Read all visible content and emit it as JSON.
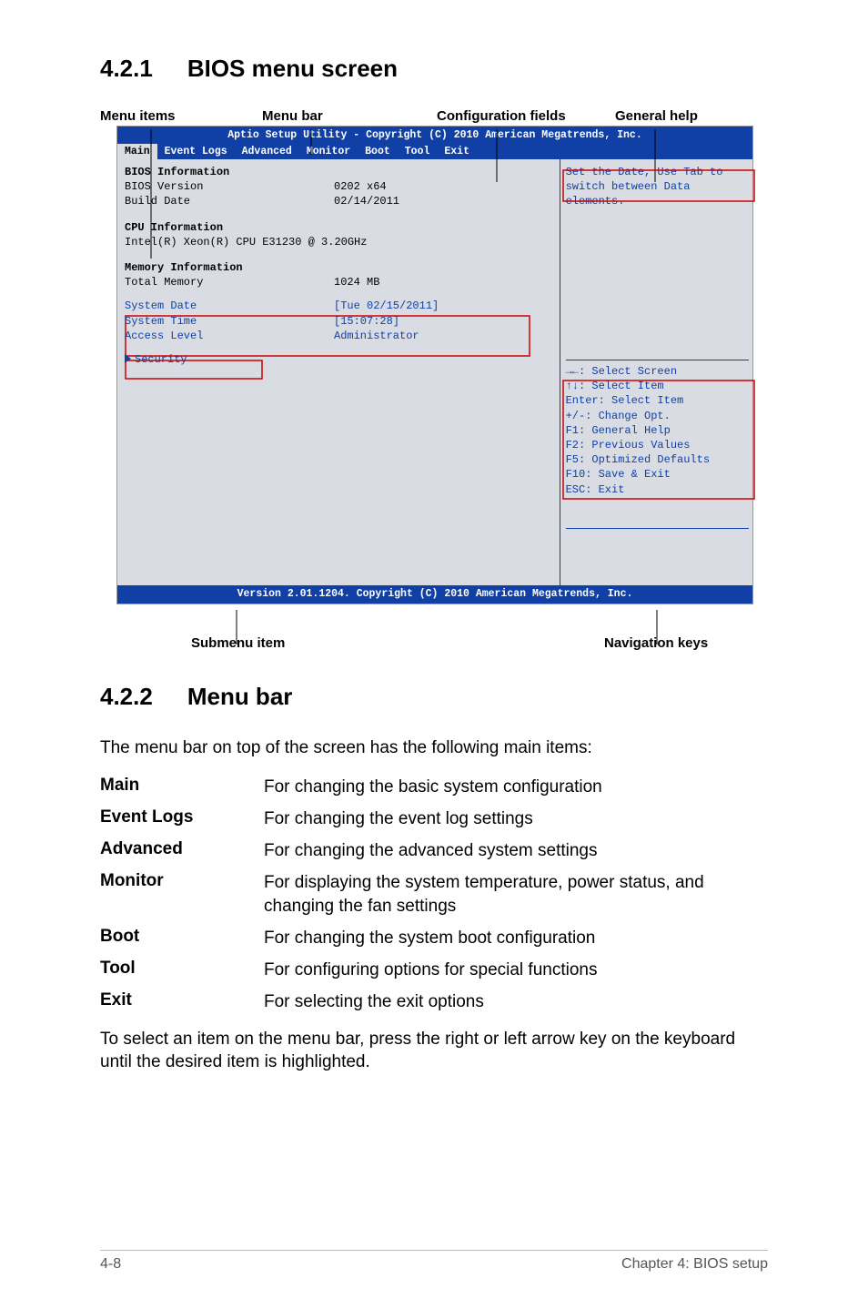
{
  "section1": {
    "num": "4.2.1",
    "title": "BIOS menu screen"
  },
  "annot": {
    "menuItems": "Menu items",
    "menuBar": "Menu bar",
    "configFields": "Configuration fields",
    "generalHelp": "General help"
  },
  "bios": {
    "header": "Aptio Setup Utility - Copyright (C) 2010 American Megatrends, Inc.",
    "menubar": [
      "Main",
      "Event Logs",
      "Advanced",
      "Monitor",
      "Boot",
      "Tool",
      "Exit"
    ],
    "left": {
      "biosInfoHdr": "BIOS Information",
      "biosVersionL": "BIOS Version",
      "biosVersionV": "0202 x64",
      "buildDateL": "Build Date",
      "buildDateV": "02/14/2011",
      "cpuInfoHdr": "CPU Information",
      "cpuLine": "Intel(R) Xeon(R) CPU E31230 @ 3.20GHz",
      "memInfoHdr": "Memory Information",
      "totalMemL": "Total Memory",
      "totalMemV": "1024 MB",
      "sysDateL": "System Date",
      "sysDateV": "[Tue 02/15/2011]",
      "sysTimeL": "System Time",
      "sysTimeV": "[15:07:28]",
      "accessL": "Access Level",
      "accessV": "Administrator",
      "security": "Security"
    },
    "right": {
      "help1": "Set the Date, Use Tab to",
      "help2": "switch between Data elements.",
      "k1": "→←: Select Screen",
      "k2": "↑↓:  Select Item",
      "k3": "Enter: Select Item",
      "k4": "+/-: Change Opt.",
      "k5": "F1: General Help",
      "k6": "F2: Previous Values",
      "k7": "F5: Optimized Defaults",
      "k8": "F10: Save & Exit",
      "k9": "ESC: Exit"
    },
    "footer": "Version 2.01.1204. Copyright (C) 2010 American Megatrends, Inc."
  },
  "bottomLabels": {
    "submenu": "Submenu item",
    "navkeys": "Navigation keys"
  },
  "section2": {
    "num": "4.2.2",
    "title": "Menu bar"
  },
  "intro": "The menu bar on top of the screen has the following main items:",
  "defs": {
    "main": {
      "t": "Main",
      "d": "For changing the basic system configuration"
    },
    "eventlogs": {
      "t": "Event Logs",
      "d": "For changing the event log settings"
    },
    "advanced": {
      "t": "Advanced",
      "d": "For changing the advanced system settings"
    },
    "monitor": {
      "t": "Monitor",
      "d": "For displaying the system temperature, power status, and changing the fan settings"
    },
    "boot": {
      "t": "Boot",
      "d": "For changing the system boot configuration"
    },
    "tool": {
      "t": "Tool",
      "d": "For configuring options for special functions"
    },
    "exit": {
      "t": "Exit",
      "d": "For selecting the exit options"
    }
  },
  "outro": "To select an item on the menu bar, press the right or left arrow key on the keyboard until the desired item is highlighted.",
  "footer": {
    "page": "4-8",
    "chapter": "Chapter 4: BIOS setup"
  }
}
